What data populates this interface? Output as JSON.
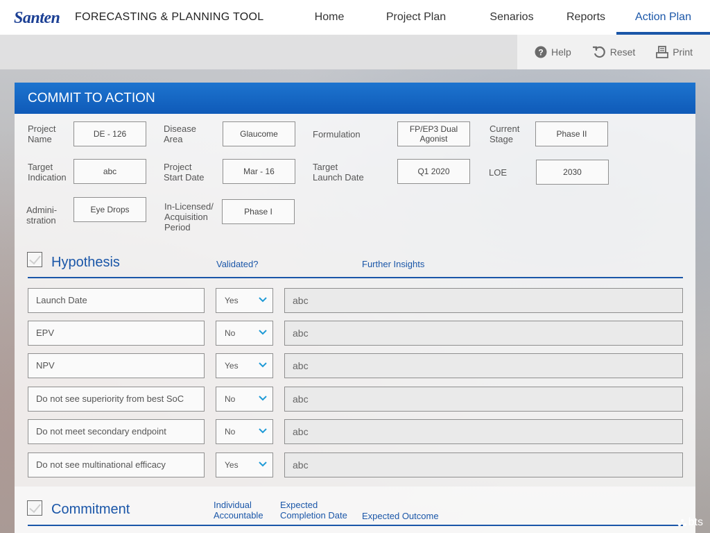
{
  "app": {
    "logo_text": "Santen",
    "title": "FORECASTING & PLANNING TOOL"
  },
  "nav": {
    "items": [
      {
        "label": "Home",
        "active": false
      },
      {
        "label": "Project Plan",
        "active": false
      },
      {
        "label": "Senarios",
        "active": false
      },
      {
        "label": "Reports",
        "active": false
      },
      {
        "label": "Action Plan",
        "active": true
      }
    ]
  },
  "toolbar": {
    "help": "Help",
    "reset": "Reset",
    "print": "Print"
  },
  "panel": {
    "title": "COMMIT TO ACTION",
    "fields": {
      "project_name": {
        "label1": "Project",
        "label2": "Name",
        "value": "DE - 126"
      },
      "disease_area": {
        "label1": "Disease",
        "label2": "Area",
        "value": "Glaucome"
      },
      "formulation": {
        "label1": "Formulation",
        "label2": "",
        "value1": "FP/EP3 Dual",
        "value2": "Agonist"
      },
      "current_stage": {
        "label1": "Current",
        "label2": "Stage",
        "value": "Phase II"
      },
      "target_indication": {
        "label1": "Target",
        "label2": "Indication",
        "value": "abc"
      },
      "project_start_date": {
        "label1": "Project",
        "label2": "Start Date",
        "value": "Mar - 16"
      },
      "target_launch_date": {
        "label1": "Target",
        "label2": "Launch Date",
        "value": "Q1 2020"
      },
      "loe": {
        "label1": "LOE",
        "label2": "",
        "value": "2030"
      },
      "administration": {
        "label1": "Admini-",
        "label2": "stration",
        "value": "Eye Drops"
      },
      "in_licensed": {
        "label1": "In-Licensed/",
        "label2": "Acquisition",
        "label3": "Period",
        "value": "Phase I"
      }
    }
  },
  "hypothesis": {
    "title": "Hypothesis",
    "col_validated": "Validated?",
    "col_insights": "Further Insights",
    "rows": [
      {
        "label": "Launch Date",
        "validated": "Yes",
        "insight": "abc"
      },
      {
        "label": "EPV",
        "validated": "No",
        "insight": "abc"
      },
      {
        "label": "NPV",
        "validated": "Yes",
        "insight": "abc"
      },
      {
        "label": "Do not see superiority from best SoC",
        "validated": "No",
        "insight": "abc"
      },
      {
        "label": "Do not meet secondary endpoint",
        "validated": "No",
        "insight": "abc"
      },
      {
        "label": "Do not see multinational efficacy",
        "validated": "Yes",
        "insight": "abc"
      }
    ]
  },
  "commitment": {
    "title": "Commitment",
    "col_individual1": "Individual",
    "col_individual2": "Accountable",
    "col_expected1": "Expected",
    "col_expected2": "Completion Date",
    "col_outcome": "Expected Outcome"
  },
  "footer": {
    "brand": "bts"
  },
  "colors": {
    "accent": "#1a56a8",
    "header_gradient_top": "#1d74cf",
    "header_gradient_bottom": "#0f5ab8"
  }
}
